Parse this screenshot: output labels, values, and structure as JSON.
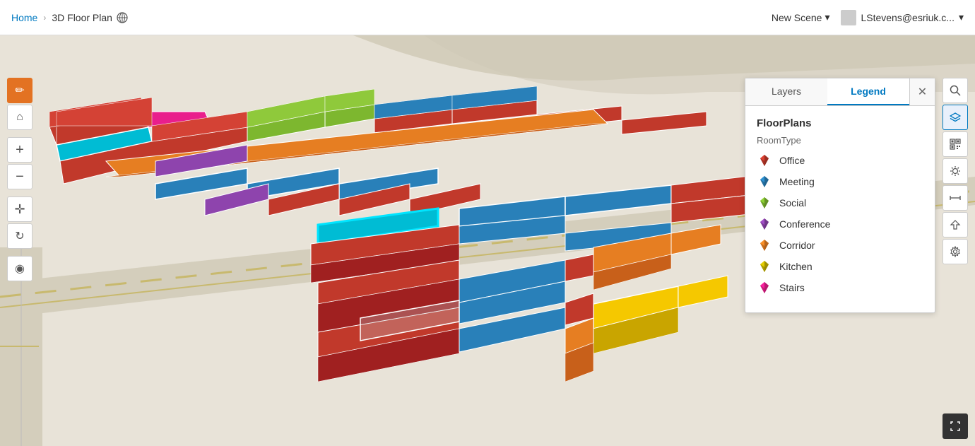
{
  "header": {
    "home_label": "Home",
    "title": "3D Floor Plan",
    "globe_symbol": "🌐",
    "new_scene_label": "New Scene",
    "dropdown_symbol": "▾",
    "user_label": "LStevens@esriuk.c...",
    "user_dropdown": "▾"
  },
  "tabs": {
    "layers": "Layers",
    "legend": "Legend"
  },
  "panel": {
    "close": "✕",
    "section_title": "FloorPlans",
    "sub_title": "RoomType",
    "active_tab": "legend",
    "items": [
      {
        "label": "Office",
        "color": "#c1392b"
      },
      {
        "label": "Meeting",
        "color": "#2980b9"
      },
      {
        "label": "Social",
        "color": "#7db72f"
      },
      {
        "label": "Conference",
        "color": "#8e44ad"
      },
      {
        "label": "Corridor",
        "color": "#e67e22"
      },
      {
        "label": "Kitchen",
        "color": "#c8b400"
      },
      {
        "label": "Stairs",
        "color": "#e91e8c"
      }
    ]
  },
  "toolbar_left": {
    "buttons": [
      {
        "id": "edit",
        "symbol": "✏",
        "active": true
      },
      {
        "id": "home",
        "symbol": "⌂",
        "active": false
      },
      {
        "id": "zoom-in",
        "symbol": "+",
        "active": false
      },
      {
        "id": "zoom-out",
        "symbol": "−",
        "active": false
      },
      {
        "id": "pan",
        "symbol": "✛",
        "active": false
      },
      {
        "id": "rotate",
        "symbol": "↻",
        "active": false
      },
      {
        "id": "compass",
        "symbol": "◉",
        "active": false
      }
    ]
  },
  "toolbar_right": {
    "buttons": [
      {
        "id": "search",
        "symbol": "🔍"
      },
      {
        "id": "layers",
        "symbol": "⊞"
      },
      {
        "id": "qr",
        "symbol": "▦"
      },
      {
        "id": "sun",
        "symbol": "☀"
      },
      {
        "id": "measure",
        "symbol": "↔"
      },
      {
        "id": "export",
        "symbol": "⬡"
      },
      {
        "id": "settings",
        "symbol": "⚙"
      }
    ]
  },
  "colors": {
    "accent": "#0079c1",
    "edit_active": "#e37222",
    "road": "#d4cebc",
    "ground": "#e8e3d8",
    "road_marking": "#c8b96e"
  }
}
